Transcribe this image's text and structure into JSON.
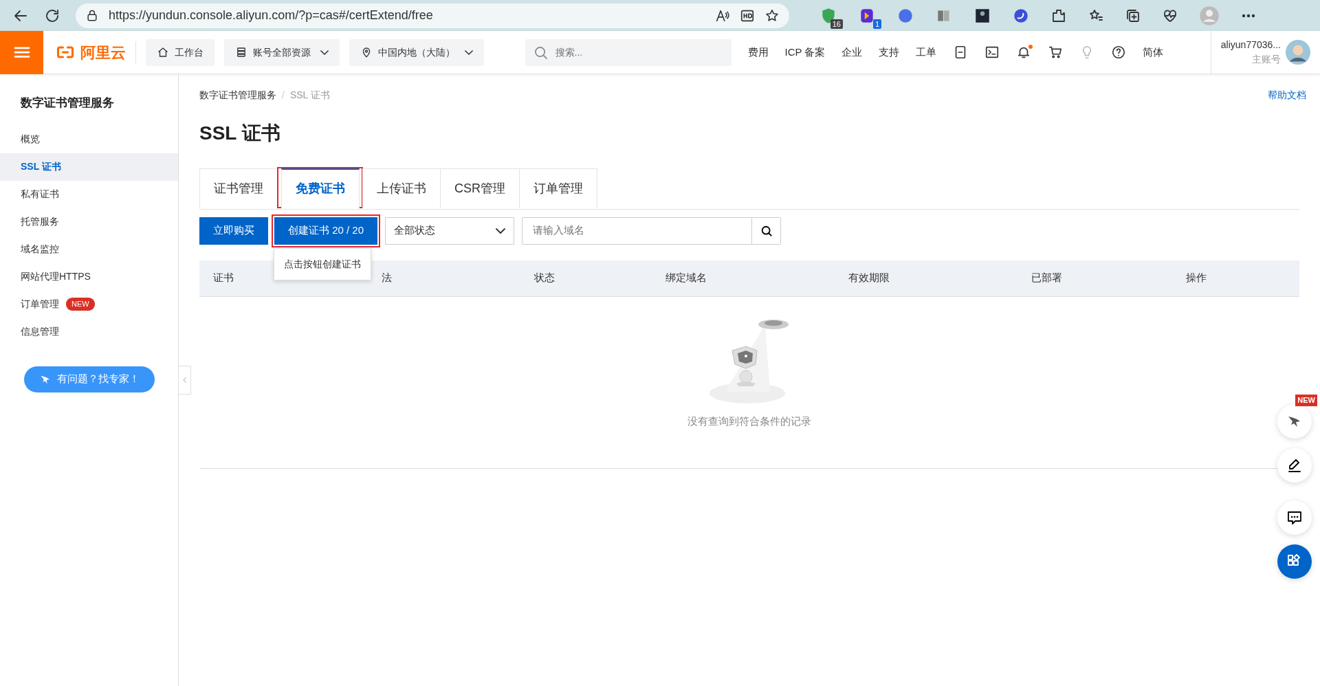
{
  "browser": {
    "url": "https://yundun.console.aliyun.com/?p=cas#/certExtend/free",
    "extensions": [
      {
        "kind": "shield",
        "badge": "16"
      },
      {
        "kind": "app",
        "badge": "1"
      },
      {
        "kind": "magic"
      },
      {
        "kind": "reader"
      },
      {
        "kind": "photo"
      },
      {
        "kind": "swirl"
      }
    ]
  },
  "header": {
    "logo": "阿里云",
    "pills": [
      {
        "kind": "home",
        "label": "工作台",
        "dropdown": false
      },
      {
        "kind": "stack",
        "label": "账号全部资源",
        "dropdown": true
      },
      {
        "kind": "pin",
        "label": "中国内地（大陆）",
        "dropdown": true
      }
    ],
    "search": {
      "placeholder": "搜索..."
    },
    "links": [
      "费用",
      "ICP 备案",
      "企业",
      "支持",
      "工单"
    ],
    "tools": [
      {
        "kind": "app"
      },
      {
        "kind": "terminal"
      },
      {
        "kind": "bell",
        "dot": true
      },
      {
        "kind": "cart"
      },
      {
        "kind": "bulb"
      },
      {
        "kind": "help"
      }
    ],
    "language": "简体",
    "user": {
      "name": "aliyun77036...",
      "role": "主账号"
    }
  },
  "sidebar": {
    "title": "数字证书管理服务",
    "items": [
      {
        "label": "概览",
        "selected": false
      },
      {
        "label": "SSL 证书",
        "selected": true
      },
      {
        "label": "私有证书",
        "selected": false
      },
      {
        "label": "托管服务",
        "selected": false
      },
      {
        "label": "域名监控",
        "selected": false
      },
      {
        "label": "网站代理HTTPS",
        "selected": false
      },
      {
        "label": "订单管理",
        "selected": false,
        "badge": "NEW"
      },
      {
        "label": "信息管理",
        "selected": false
      }
    ],
    "expert_button": "有问题？找专家！"
  },
  "breadcrumb": [
    "数字证书管理服务",
    "SSL 证书"
  ],
  "breadcrumb_separator": "/",
  "help_link": "帮助文档",
  "title": "SSL 证书",
  "tabs": [
    {
      "label": "证书管理",
      "selected": false,
      "annotated": false
    },
    {
      "label": "免费证书",
      "selected": true,
      "annotated": true
    },
    {
      "label": "上传证书",
      "selected": false,
      "annotated": false
    },
    {
      "label": "CSR管理",
      "selected": false,
      "annotated": false
    },
    {
      "label": "订单管理",
      "selected": false,
      "annotated": false
    }
  ],
  "toolbar": {
    "buttons": [
      {
        "label": "立即购买",
        "annotated": false
      },
      {
        "label": "创建证书 20 / 20",
        "annotated": true,
        "tooltip": "点击按钮创建证书"
      }
    ],
    "status_select": "全部状态",
    "domain_search": {
      "placeholder": "请输入域名"
    }
  },
  "table": {
    "columns": [
      "证书",
      "法",
      "状态",
      "绑定域名",
      "有效期限",
      "已部署",
      "操作"
    ],
    "empty_text": "没有查询到符合条件的记录"
  },
  "float_buttons": [
    {
      "kind": "bird",
      "badge": "NEW"
    },
    {
      "kind": "edit"
    },
    {
      "kind": "chat"
    },
    {
      "kind": "apps"
    }
  ]
}
